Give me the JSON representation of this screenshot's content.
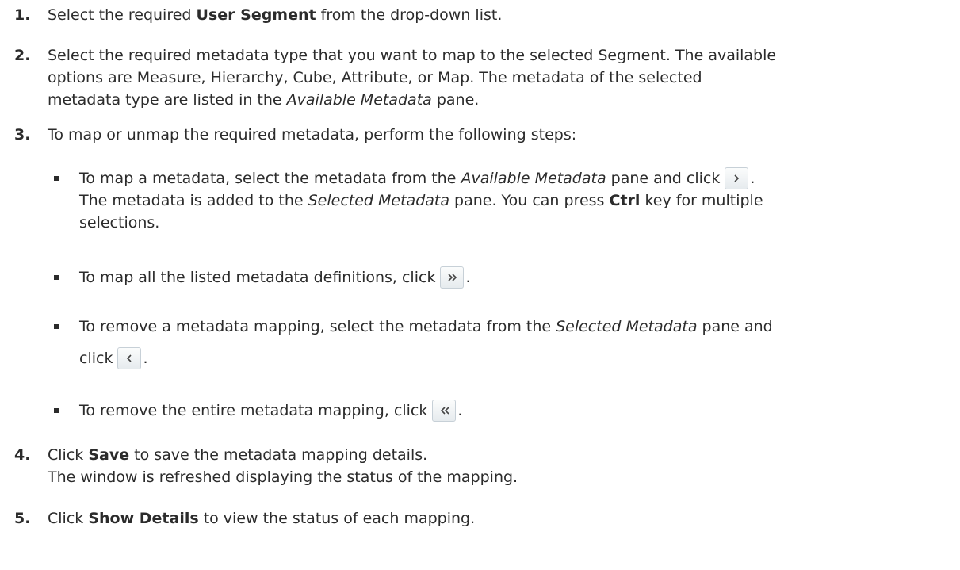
{
  "steps": [
    {
      "num": "1.",
      "a": "Select the required ",
      "b": "User Segment",
      "c": " from the drop-down list."
    },
    {
      "num": "2.",
      "l1": "Select the required metadata type that you want to map to the selected Segment. The available",
      "l2": "options are Measure, Hierarchy, Cube, Attribute, or Map. The metadata of the selected",
      "l3a": "metadata type are listed in the ",
      "l3i": "Available Metadata",
      "l3b": " pane."
    },
    {
      "num": "3.",
      "text": "To map or unmap the required metadata, perform the following steps:"
    },
    {
      "num": "4.",
      "a": "Click ",
      "b": "Save",
      "c": " to save the metadata mapping details.",
      "l2": "The window is refreshed displaying the status of the mapping."
    },
    {
      "num": "5.",
      "a": "Click ",
      "b": "Show Details",
      "c": " to view the status of each mapping."
    }
  ],
  "bullets": [
    {
      "l1a": "To map a metadata, select the metadata from the ",
      "l1i": "Available Metadata",
      "l1b": " pane and click",
      "l1end": ".",
      "l2a": "The metadata is added to the ",
      "l2i": "Selected Metadata",
      "l2b": " pane. You can press ",
      "l2bold": "Ctrl",
      "l2c": " key for multiple",
      "l3": "selections."
    },
    {
      "a": "To map all the listed metadata definitions, click",
      "end": "."
    },
    {
      "l1a": "To remove a metadata mapping, select the metadata from the ",
      "l1i": "Selected Metadata",
      "l1b": " pane and",
      "l2": "click",
      "end": "."
    },
    {
      "a": "To remove the entire metadata mapping, click",
      "end": "."
    }
  ],
  "icons": {
    "select": "chevron-right-icon",
    "select_all": "double-chevron-right-icon",
    "deselect": "chevron-left-icon",
    "deselect_all": "double-chevron-left-icon"
  }
}
